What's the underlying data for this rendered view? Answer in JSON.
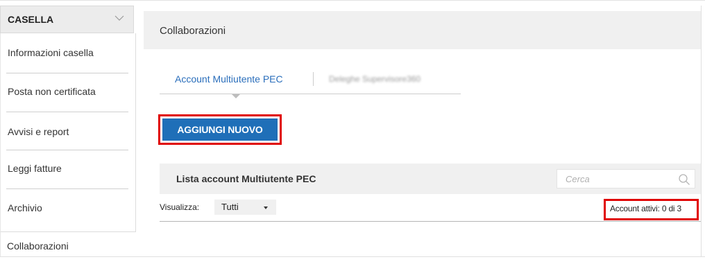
{
  "sidebar": {
    "header": "CASELLA",
    "items": [
      {
        "label": "Informazioni casella"
      },
      {
        "label": "Posta non certificata"
      },
      {
        "label": "Avvisi e report"
      },
      {
        "label": "Leggi fatture"
      },
      {
        "label": "Archivio"
      },
      {
        "label": "Collaborazioni"
      }
    ]
  },
  "main": {
    "title": "Collaborazioni",
    "tabs": [
      {
        "label": "Account Multiutente PEC",
        "active": true
      },
      {
        "label": "Deleghe Supervisore360",
        "active": false
      }
    ],
    "add_button": "AGGIUNGI NUOVO",
    "list": {
      "title": "Lista account Multiutente PEC",
      "search_placeholder": "Cerca",
      "filter_label": "Visualizza:",
      "filter_value": "Tutti",
      "active_count": "Account attivi: 0 di 3"
    }
  },
  "colors": {
    "accent": "#1f6fb8",
    "tab_active": "#2a6ebb",
    "highlight": "#e00000"
  }
}
